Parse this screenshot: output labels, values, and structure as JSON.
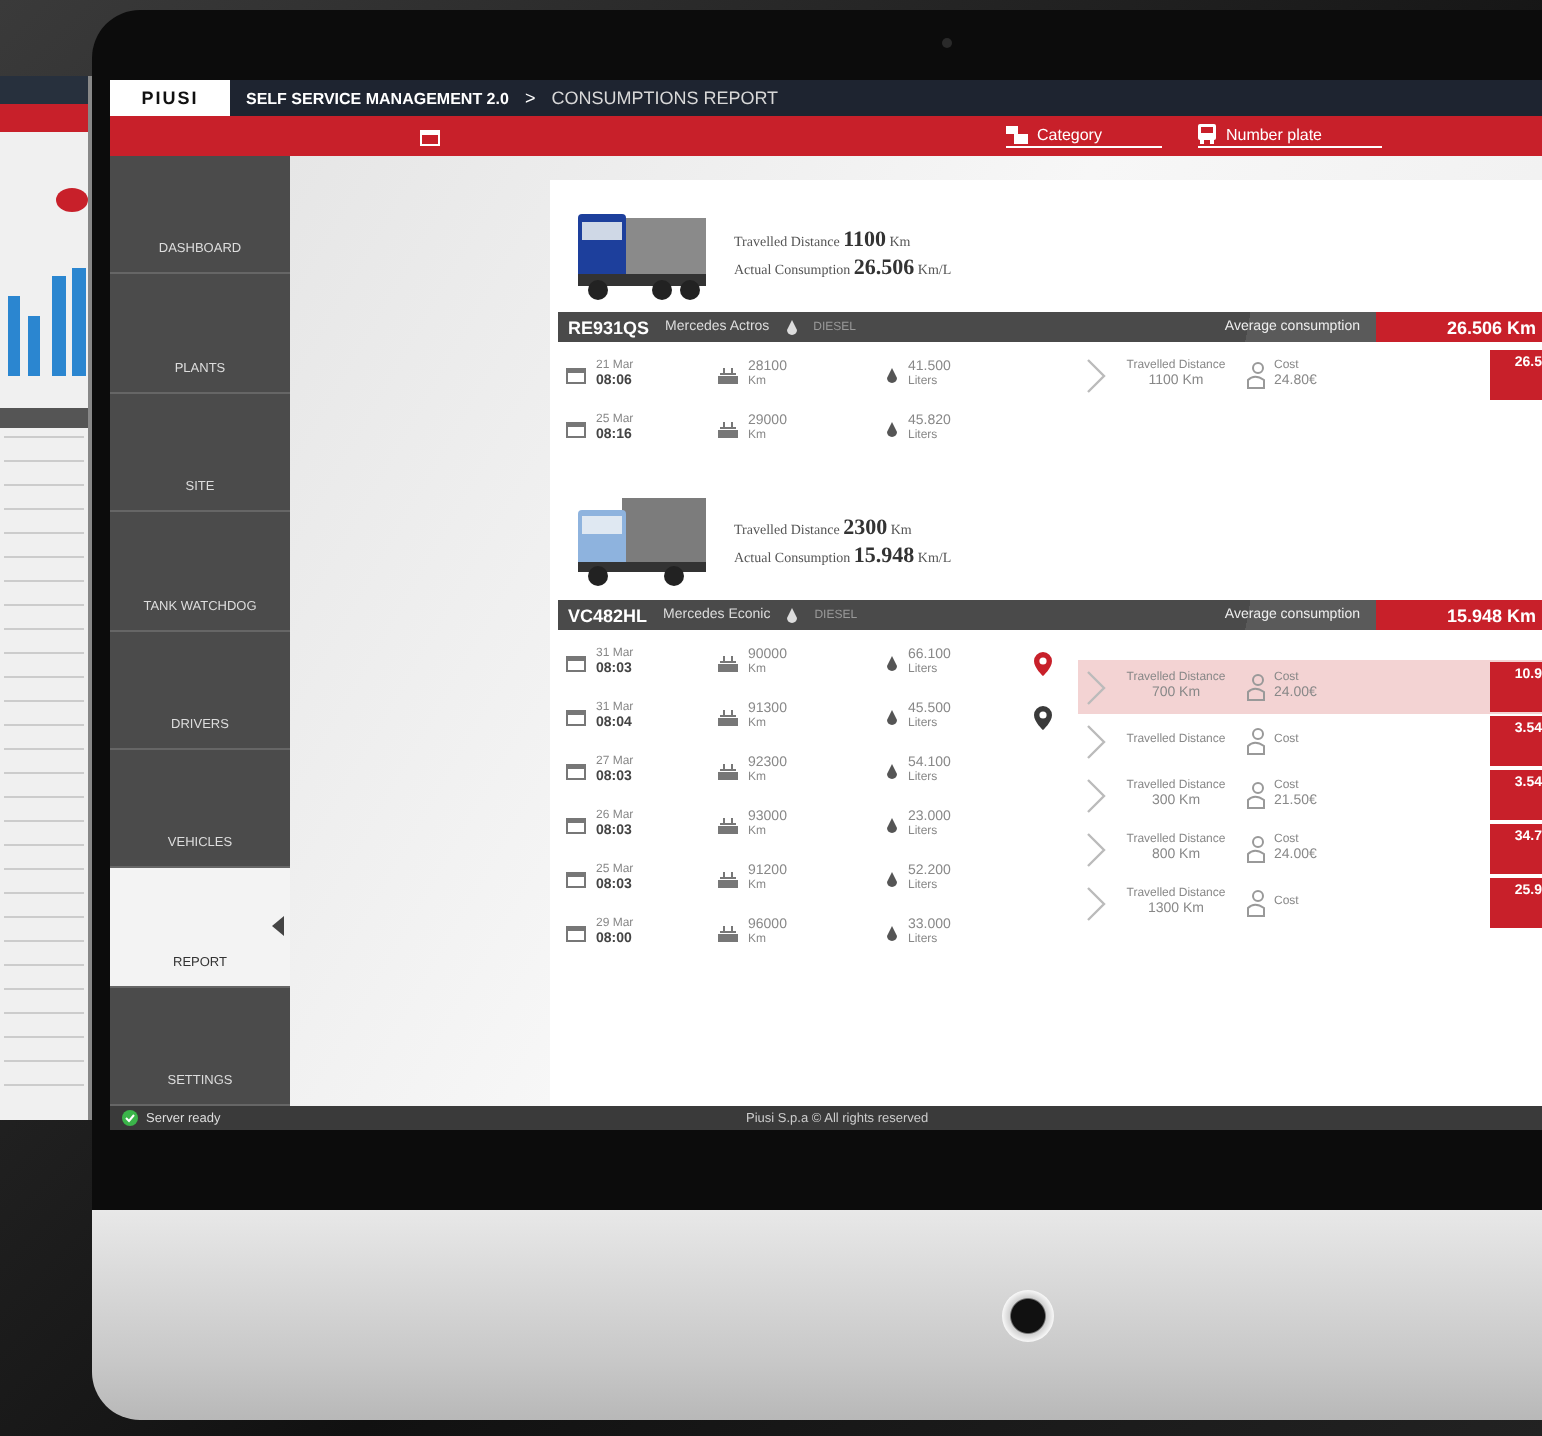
{
  "app": {
    "logo": "PIUSI",
    "title": "SELF SERVICE MANAGEMENT 2.0",
    "breadcrumb_separator": ">",
    "page": "CONSUMPTIONS REPORT"
  },
  "filters": [
    {
      "label": "Category",
      "kind": "category"
    },
    {
      "label": "Number plate",
      "kind": "plate"
    }
  ],
  "sidebar": {
    "items": [
      {
        "label": "DASHBOARD",
        "selected": false
      },
      {
        "label": "PLANTS",
        "selected": false
      },
      {
        "label": "SITE",
        "selected": false
      },
      {
        "label": "TANK WATCHDOG",
        "selected": false
      },
      {
        "label": "DRIVERS",
        "selected": false
      },
      {
        "label": "VEHICLES",
        "selected": false
      },
      {
        "label": "REPORT",
        "selected": true
      },
      {
        "label": "SETTINGS",
        "selected": false
      }
    ]
  },
  "vehicles": [
    {
      "kind": "dump",
      "plate": "RE931QS",
      "model": "Mercedes Actros",
      "fuel": "DIESEL",
      "travelled_label": "Travelled Distance",
      "travelled_value": "1100",
      "travelled_unit": "Km",
      "consumption_label": "Actual Consumption",
      "consumption_value": "26.506",
      "consumption_unit": "Km/L",
      "average_label": "Average consumption",
      "average_value": "26.506",
      "average_unit": "Km",
      "readings": [
        {
          "date": "21 Mar",
          "time": "08:06",
          "odometer": "28100",
          "odometer_unit": "Km",
          "liters": "41.500",
          "liters_unit": "Liters"
        },
        {
          "date": "25 Mar",
          "time": "08:16",
          "odometer": "29000",
          "odometer_unit": "Km",
          "liters": "45.820",
          "liters_unit": "Liters"
        }
      ],
      "segments": [
        {
          "distance_label": "Travelled Distance",
          "distance": "1100 Km",
          "cost_label": "Cost",
          "cost": "24.80€",
          "value": "26.5",
          "selected": false
        }
      ]
    },
    {
      "kind": "box",
      "plate": "VC482HL",
      "model": "Mercedes Econic",
      "fuel": "DIESEL",
      "travelled_label": "Travelled Distance",
      "travelled_value": "2300",
      "travelled_unit": "Km",
      "consumption_label": "Actual Consumption",
      "consumption_value": "15.948",
      "consumption_unit": "Km/L",
      "average_label": "Average consumption",
      "average_value": "15.948",
      "average_unit": "Km",
      "readings": [
        {
          "date": "31 Mar",
          "time": "08:03",
          "odometer": "90000",
          "odometer_unit": "Km",
          "liters": "66.100",
          "liters_unit": "Liters",
          "color": "#c8202a"
        },
        {
          "date": "31 Mar",
          "time": "08:04",
          "odometer": "91300",
          "odometer_unit": "Km",
          "liters": "45.500",
          "liters_unit": "Liters",
          "color": "#3a3a3a"
        },
        {
          "date": "27 Mar",
          "time": "08:03",
          "odometer": "92300",
          "odometer_unit": "Km",
          "liters": "54.100",
          "liters_unit": "Liters"
        },
        {
          "date": "26 Mar",
          "time": "08:03",
          "odometer": "93000",
          "odometer_unit": "Km",
          "liters": "23.000",
          "liters_unit": "Liters"
        },
        {
          "date": "25 Mar",
          "time": "08:03",
          "odometer": "91200",
          "odometer_unit": "Km",
          "liters": "52.200",
          "liters_unit": "Liters"
        },
        {
          "date": "29 Mar",
          "time": "08:00",
          "odometer": "96000",
          "odometer_unit": "Km",
          "liters": "33.000",
          "liters_unit": "Liters"
        }
      ],
      "segments": [
        {
          "distance_label": "Travelled Distance",
          "distance": "700 Km",
          "cost_label": "Cost",
          "cost": "24.00€",
          "value": "10.9",
          "selected": true
        },
        {
          "distance_label": "Travelled Distance",
          "cost_label": "Cost",
          "value": "3.54",
          "selected": false
        },
        {
          "distance_label": "Travelled Distance",
          "distance": "300 Km",
          "cost_label": "Cost",
          "cost": "21.50€",
          "value": "3.54",
          "selected": false
        },
        {
          "distance_label": "Travelled Distance",
          "distance": "800 Km",
          "cost_label": "Cost",
          "cost": "24.00€",
          "value": "34.7",
          "selected": false
        },
        {
          "distance_label": "Travelled Distance",
          "distance": "1300 Km",
          "cost_label": "Cost",
          "value": "25.9",
          "selected": false
        }
      ]
    }
  ],
  "status_bar": {
    "status": "Server ready",
    "copyright": "Piusi S.p.a © All rights reserved"
  }
}
